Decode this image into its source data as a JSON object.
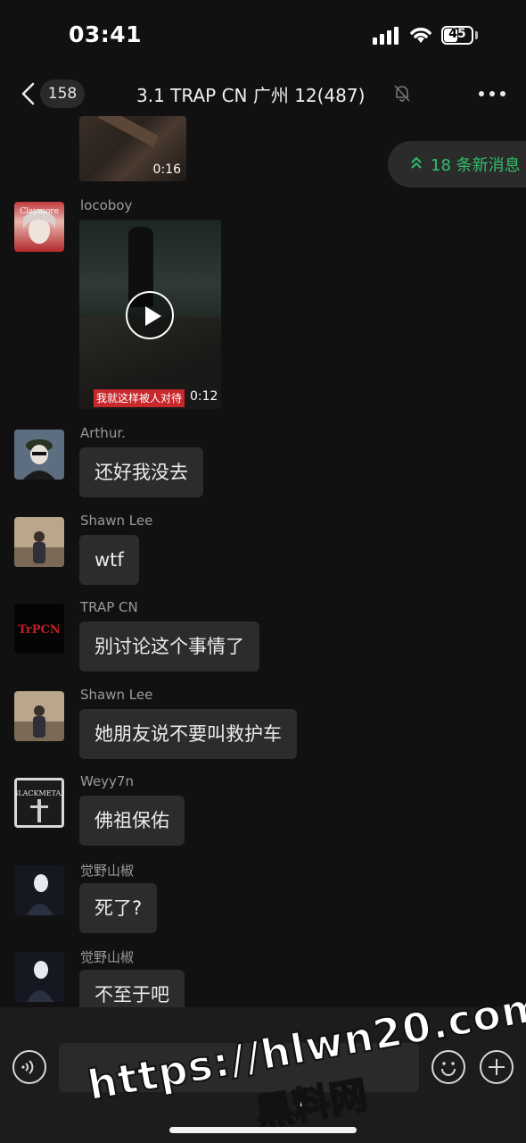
{
  "status_bar": {
    "time": "03:41",
    "battery": "45"
  },
  "nav": {
    "back_count": "158",
    "title": "3.1 TRAP CN 广州 12(487)"
  },
  "new_messages": {
    "label": "18 条新消息"
  },
  "top_video": {
    "duration": "0:16"
  },
  "messages": [
    {
      "sender": "locoboy",
      "type": "video",
      "caption": "我就这样被人对待",
      "duration": "0:12"
    },
    {
      "sender": "Arthur.",
      "text": "还好我没去"
    },
    {
      "sender": "Shawn Lee",
      "text": "wtf"
    },
    {
      "sender": "TRAP CN",
      "text": "别讨论这个事情了"
    },
    {
      "sender": "Shawn Lee",
      "text": "她朋友说不要叫救护车"
    },
    {
      "sender": "Weyy7n",
      "text": "佛祖保佑"
    },
    {
      "sender": "觉野山椒",
      "text": "死了?"
    },
    {
      "sender": "觉野山椒",
      "text": "不至于吧"
    }
  ],
  "input": {
    "value": ""
  },
  "watermark": {
    "line1": "https://hlwn20.com",
    "line2": "黑料网"
  },
  "colors": {
    "background": "#111111",
    "bubble": "#2c2c2c",
    "accent_green": "#2fbf67",
    "caption_red": "#c7282c"
  }
}
